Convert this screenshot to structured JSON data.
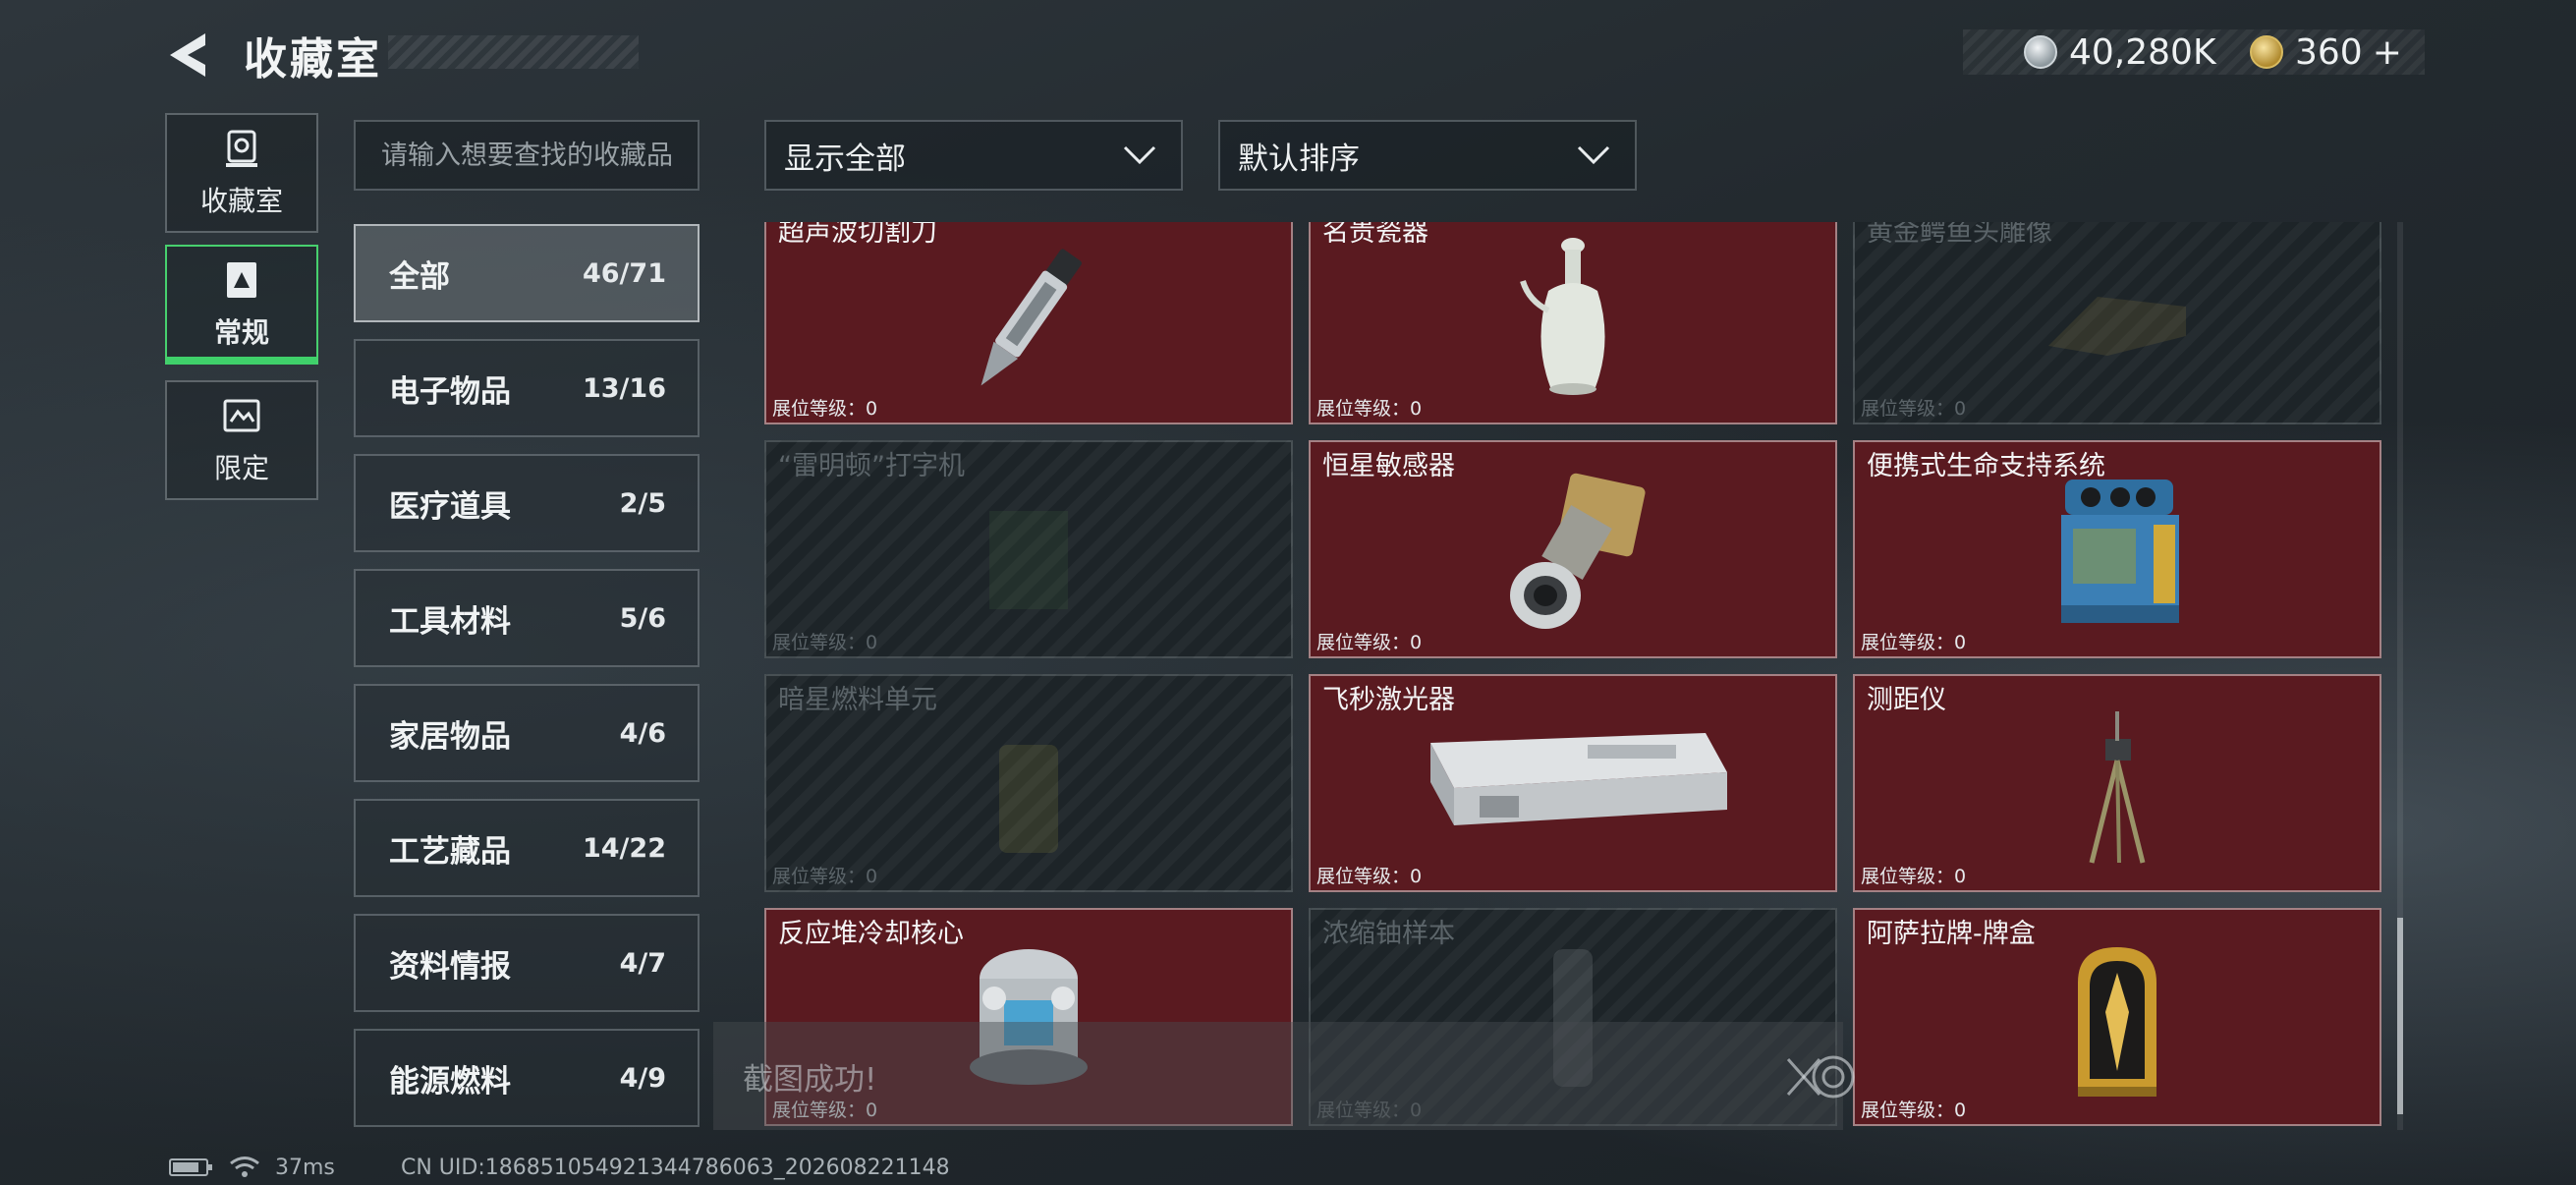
{
  "header": {
    "title": "收藏室"
  },
  "currency": {
    "silver": "40,280K",
    "gold": "360",
    "gold_add": "+"
  },
  "side_nav": [
    {
      "label": "收藏室",
      "icon": "trophy-icon",
      "active": false
    },
    {
      "label": "常规",
      "icon": "document-icon",
      "active": true
    },
    {
      "label": "限定",
      "icon": "ticket-icon",
      "active": false
    }
  ],
  "search": {
    "placeholder": "请输入想要查找的收藏品",
    "value": ""
  },
  "filter": {
    "label": "显示全部"
  },
  "sort": {
    "label": "默认排序"
  },
  "categories": [
    {
      "name": "全部",
      "count": "46/71",
      "active": true
    },
    {
      "name": "电子物品",
      "count": "13/16"
    },
    {
      "name": "医疗道具",
      "count": "2/5"
    },
    {
      "name": "工具材料",
      "count": "5/6"
    },
    {
      "name": "家居物品",
      "count": "4/6"
    },
    {
      "name": "工艺藏品",
      "count": "14/22"
    },
    {
      "name": "资料情报",
      "count": "4/7"
    },
    {
      "name": "能源燃料",
      "count": "4/9"
    }
  ],
  "items": [
    {
      "name": "超声波切割刀",
      "level": "展位等级：0",
      "unlocked": true,
      "icon": "cutter-knife-icon"
    },
    {
      "name": "名贵瓷器",
      "level": "展位等级：0",
      "unlocked": true,
      "icon": "porcelain-vase-icon"
    },
    {
      "name": "黄金鳄鱼头雕像",
      "level": "展位等级：0",
      "unlocked": false,
      "icon": "crocodile-statue-icon"
    },
    {
      "name": "“雷明顿”打字机",
      "level": "展位等级：0",
      "unlocked": false,
      "icon": "typewriter-icon"
    },
    {
      "name": "恒星敏感器",
      "level": "展位等级：0",
      "unlocked": true,
      "icon": "star-sensor-icon"
    },
    {
      "name": "便携式生命支持系统",
      "level": "展位等级：0",
      "unlocked": true,
      "icon": "life-support-icon"
    },
    {
      "name": "暗星燃料单元",
      "level": "展位等级：0",
      "unlocked": false,
      "icon": "fuel-cell-icon"
    },
    {
      "name": "飞秒激光器",
      "level": "展位等级：0",
      "unlocked": true,
      "icon": "laser-device-icon"
    },
    {
      "name": "测距仪",
      "level": "展位等级：0",
      "unlocked": true,
      "icon": "rangefinder-tripod-icon"
    },
    {
      "name": "反应堆冷却核心",
      "level": "展位等级：0",
      "unlocked": true,
      "icon": "reactor-core-icon"
    },
    {
      "name": "浓缩铀样本",
      "level": "展位等级：0",
      "unlocked": false,
      "icon": "uranium-sample-icon"
    },
    {
      "name": "阿萨拉牌-牌盒",
      "level": "展位等级：0",
      "unlocked": true,
      "icon": "card-box-icon"
    }
  ],
  "toast": {
    "text": "截图成功!"
  },
  "status": {
    "ping": "37ms",
    "uid": "CN UID:186851054921344786063_202608221148"
  },
  "colors": {
    "accent_green": "#3fd06a",
    "card_unlocked": "#5a1a20",
    "card_locked": "#1d2428"
  }
}
